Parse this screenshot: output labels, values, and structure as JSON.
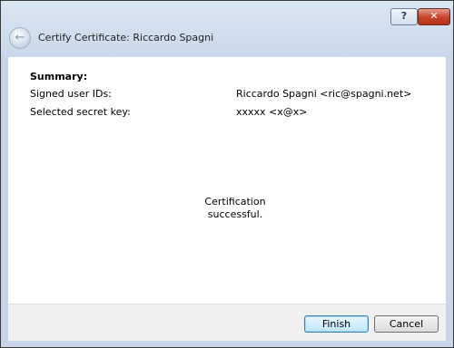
{
  "window": {
    "title": "Certify Certificate: Riccardo Spagni",
    "help_label": "?",
    "close_label": "✕",
    "back_icon": "back-arrow-icon"
  },
  "summary": {
    "heading": "Summary:",
    "rows": [
      {
        "label": "Signed user IDs:",
        "value": "Riccardo Spagni <ric@spagni.net>"
      },
      {
        "label": "Selected secret key:",
        "value": "xxxxx <x@x>"
      }
    ]
  },
  "status": {
    "line1": "Certification",
    "line2": "successful."
  },
  "buttons": {
    "finish_label": "Finish",
    "cancel_label": "Cancel"
  }
}
